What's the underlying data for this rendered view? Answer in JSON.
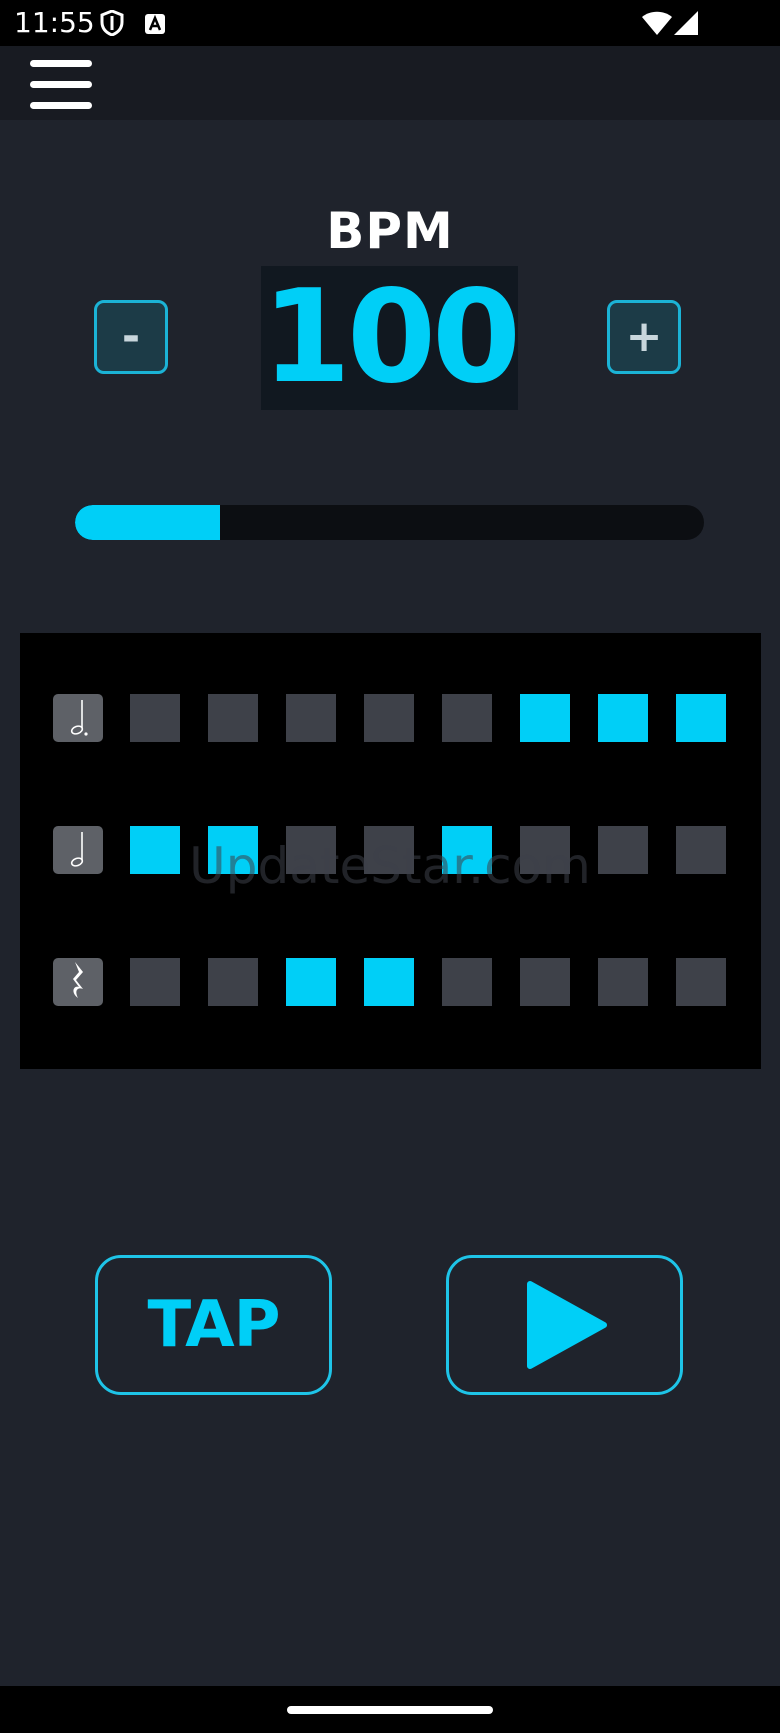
{
  "status_bar": {
    "time": "11:55",
    "left_icons": [
      "shield-icon",
      "text-a-icon"
    ],
    "right_icons": [
      "wifi-icon",
      "cellular-signal-icon"
    ]
  },
  "app_bar": {
    "menu_icon": "hamburger-menu-icon"
  },
  "tempo": {
    "label": "BPM",
    "value": "100",
    "decrease_label": "-",
    "increase_label": "+"
  },
  "progress": {
    "fraction": 0.23
  },
  "beat_grid": {
    "rows": [
      {
        "note": "dotted-half-note-icon",
        "steps": [
          false,
          false,
          false,
          false,
          false,
          true,
          true,
          true
        ]
      },
      {
        "note": "half-note-icon",
        "steps": [
          true,
          true,
          false,
          false,
          true,
          false,
          false,
          false
        ]
      },
      {
        "note": "quarter-rest-icon",
        "steps": [
          false,
          false,
          true,
          true,
          false,
          false,
          false,
          false
        ]
      }
    ]
  },
  "watermark": "UpdateStar.com",
  "controls": {
    "tap_label": "TAP",
    "play_icon": "play-icon"
  },
  "colors": {
    "accent": "#00cff7",
    "background": "#1f232c",
    "cell_off": "#3e4149",
    "grid_bg": "#000000"
  }
}
